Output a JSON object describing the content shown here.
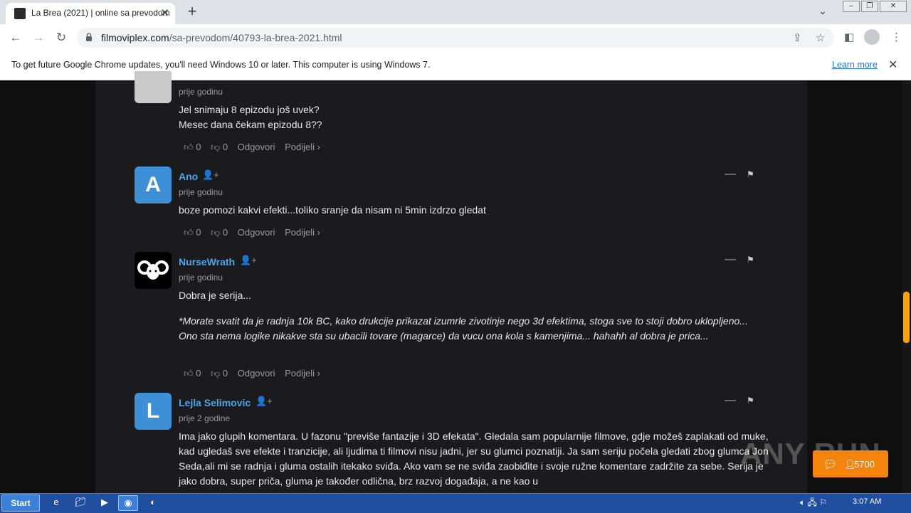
{
  "tab": {
    "title": "La Brea (2021) | online sa prevodom",
    "close": "✕",
    "new_tab": "+"
  },
  "toolbar": {
    "back": "←",
    "forward": "→",
    "reload": "↻",
    "url_domain": "filmoviplex.com",
    "url_path": "/sa-prevodom/40793-la-brea-2021.html"
  },
  "infobar": {
    "text": "To get future Google Chrome updates, you'll need Windows 10 or later. This computer is using Windows 7.",
    "learn_more": "Learn more",
    "close": "✕"
  },
  "comments": [
    {
      "timestamp": "prije godinu",
      "lines": [
        "Jel snimaju 8 epizodu još uvek?",
        "Mesec dana čekam epizodu 8??"
      ],
      "likes": "0",
      "dislikes": "0"
    },
    {
      "avatar_letter": "A",
      "name": "Ano",
      "timestamp": "prije godinu",
      "text": "boze pomozi kakvi efekti...toliko sranje da nisam ni 5min izdrzo gledat",
      "likes": "0",
      "dislikes": "0"
    },
    {
      "name": "NurseWrath",
      "timestamp": "prije godinu",
      "text": "Dobra je serija...",
      "text_italic": "*Morate svatit da je radnja 10k BC, kako drukcije prikazat izumrle zivotinje nego 3d efektima, stoga sve to stoji dobro uklopljeno... Ono sta nema logike nikakve sta su ubacili tovare (magarce) da vucu ona kola s kamenjima... hahahh al dobra je prica...",
      "likes": "0",
      "dislikes": "0"
    },
    {
      "avatar_letter": "L",
      "name": "Lejla Selimovic",
      "timestamp": "prije 2 godine",
      "text": "Ima jako glupih komentara. U fazonu \"previše fantazije i 3D efekata\". Gledala sam popularnije filmove, gdje možeš zaplakati od muke, kad ugledaš sve efekte i tranzicije, ali ljudima ti filmovi nisu jadni, jer su glumci poznatiji. Ja sam seriju počela gledati zbog glumca Jon Seda,ali mi se radnja i gluma ostalih itekako sviđa. Ako vam se ne sviđa zaobiđite i svoje ružne komentare zadržite za sebe. Serija je jako dobra, super priča, gluma je također odlična, brz razvoj događaja, a ne kao u"
    }
  ],
  "actions": {
    "reply": "Odgovori",
    "share": "Podijeli ›"
  },
  "chat_widget": {
    "count": "5700"
  },
  "watermark": "ANY  RUN",
  "taskbar": {
    "start": "Start",
    "clock": "3:07 AM"
  },
  "colors": {
    "accent": "#4ca6e8",
    "orange": "#f5840c",
    "avatar_blue": "#3d8fd6"
  }
}
